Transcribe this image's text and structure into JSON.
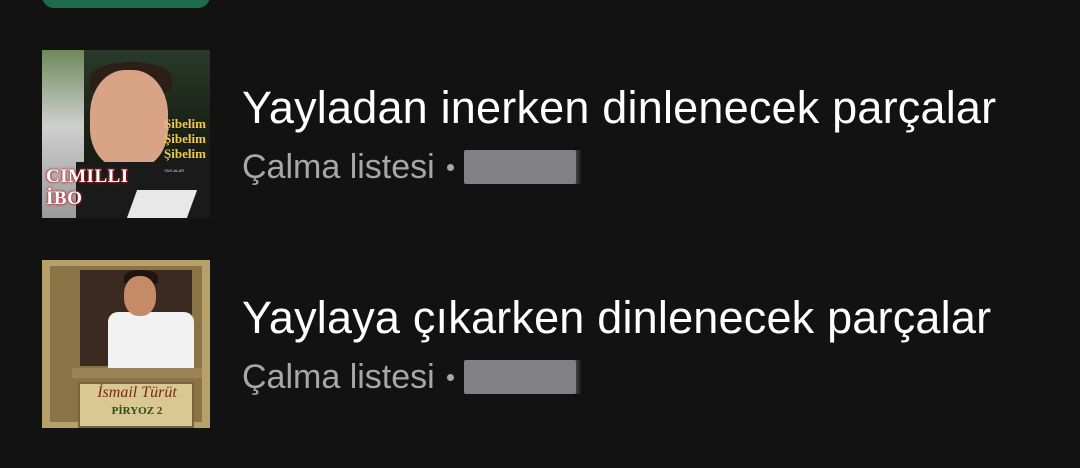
{
  "playlists": [
    {
      "title": "Yayladan inerken dinlenecek parçalar",
      "type_label": "Çalma listesi",
      "cover": {
        "main": "CIMILLI İBO",
        "side": "Şibelim Şibelim Şibelim",
        "small": "YAYLALAR"
      }
    },
    {
      "title": "Yaylaya çıkarken dinlenecek parçalar",
      "type_label": "Çalma listesi",
      "cover": {
        "main": "İsmail Türüt",
        "sub": "PİRYOZ 2"
      }
    }
  ],
  "colors": {
    "background": "#121212",
    "primary_text": "#ffffff",
    "secondary_text": "#a7a7a7",
    "accent": "#1e6b4e",
    "redaction": "#808085"
  }
}
